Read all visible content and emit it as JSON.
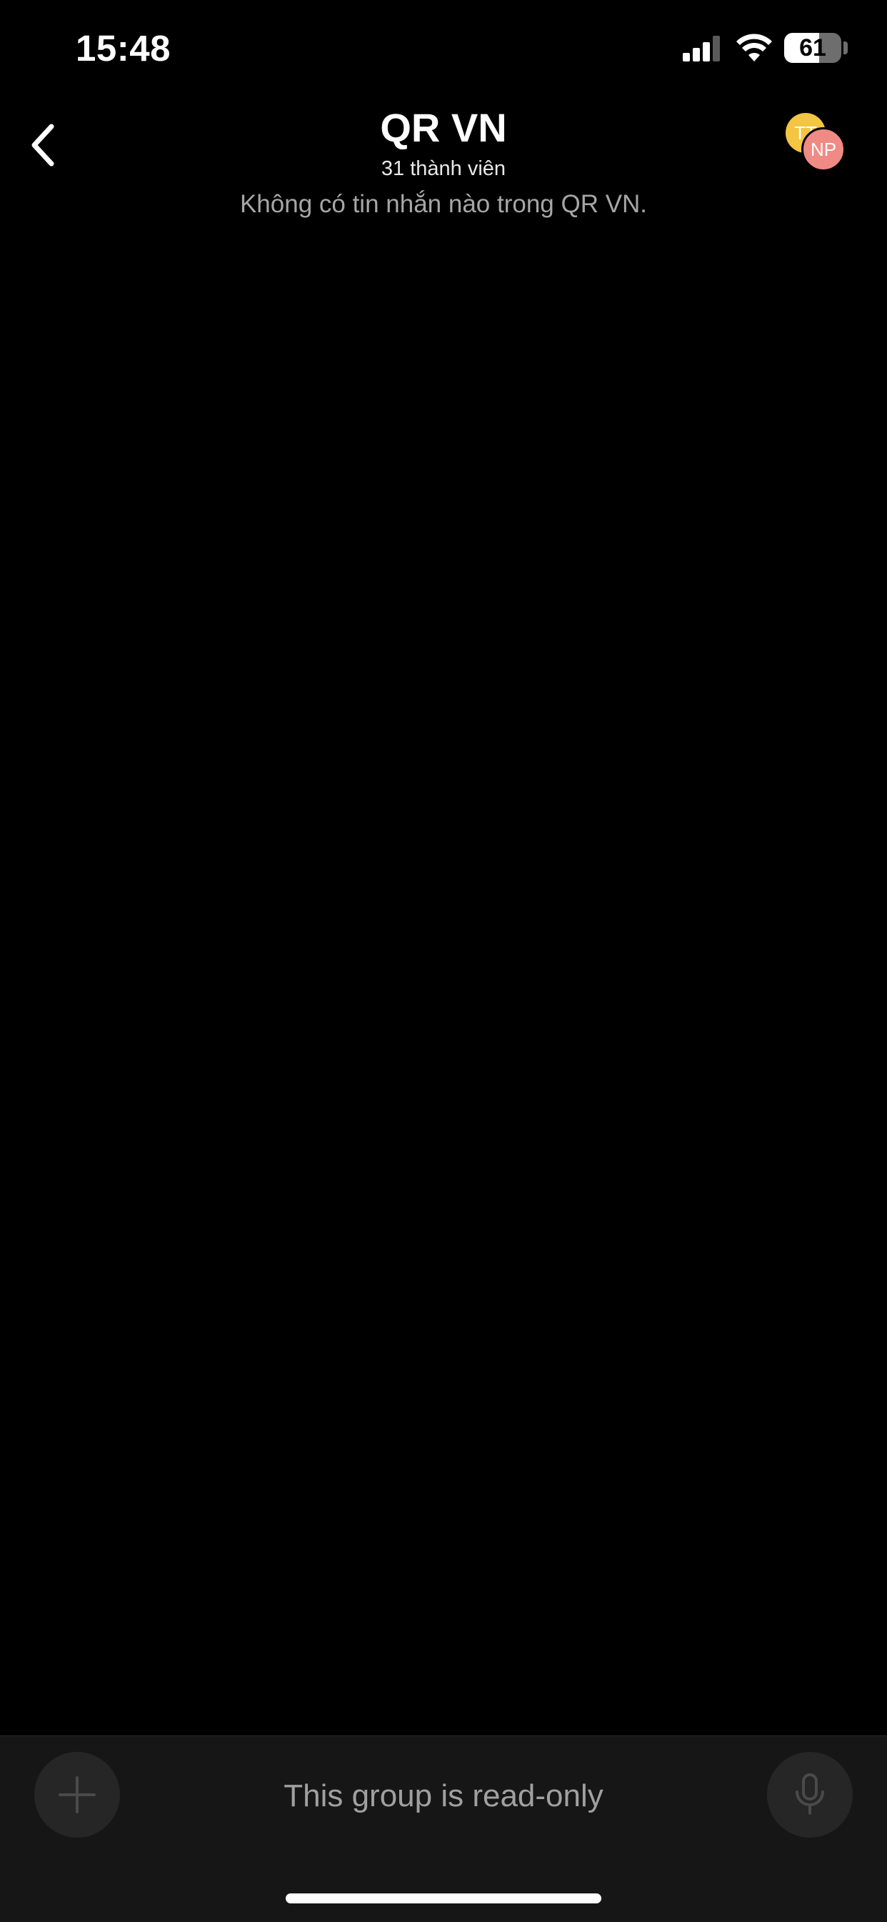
{
  "status_bar": {
    "time": "15:48",
    "battery_level": "61",
    "battery_fraction": 0.61
  },
  "header": {
    "back_icon": "chevron-left-icon",
    "title": "QR VN",
    "subtitle": "31 thành viên",
    "empty_message": "Không có tin nhắn nào trong QR VN.",
    "avatars": [
      {
        "initials": "TT",
        "color": "#f4c542"
      },
      {
        "initials": "NP",
        "color": "#f08a85"
      }
    ]
  },
  "composer": {
    "add_icon": "plus-icon",
    "mic_icon": "microphone-icon",
    "readonly_text": "This group is read-only"
  }
}
